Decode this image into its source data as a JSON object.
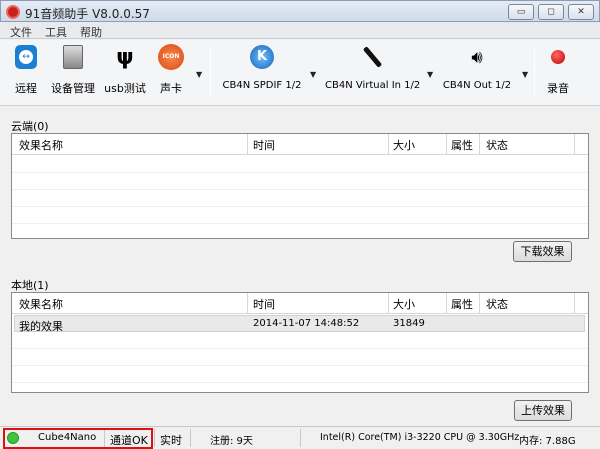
{
  "window": {
    "title": "91音频助手 V8.0.0.57",
    "minimize": "▭",
    "maximize": "◻",
    "close": "✕"
  },
  "menu": [
    "文件",
    "工具",
    "帮助"
  ],
  "toolbar": {
    "items": [
      {
        "label": "远程",
        "icon": "teamviewer-icon"
      },
      {
        "label": "设备管理",
        "icon": "device-manager-icon"
      },
      {
        "label": "usb测试",
        "icon": "usb-icon"
      },
      {
        "label": "声卡",
        "icon": "icon-soundcard-logo",
        "logo_text": "ICON"
      },
      {
        "label": "CB4N SPDIF 1/2",
        "icon": "k-logo-icon",
        "logo_text": "K"
      },
      {
        "label": "CB4N Virtual In 1/2",
        "icon": "microphone-icon"
      },
      {
        "label": "CB4N Out 1/2",
        "icon": "speaker-icon"
      },
      {
        "label": "录音",
        "icon": "record-icon"
      }
    ],
    "dropdown_arrow": "▼"
  },
  "cloud": {
    "label": "云端(0)",
    "columns": [
      "效果名称",
      "时间",
      "大小",
      "属性",
      "状态"
    ],
    "rows": [],
    "button": "下载效果"
  },
  "local": {
    "label": "本地(1)",
    "columns": [
      "效果名称",
      "时间",
      "大小",
      "属性",
      "状态"
    ],
    "rows": [
      {
        "name": "我的效果",
        "time": "2014-11-07 14:48:52",
        "size": "31849",
        "attr": "",
        "status": ""
      }
    ],
    "button": "上传效果"
  },
  "status": {
    "indicator_color": "#3cc43c",
    "device": "Cube4Nano",
    "channel": "通道OK",
    "mode": "实时",
    "registration": "注册: 9天",
    "cpu": "Intel(R) Core(TM) i3-3220 CPU @ 3.30GHz",
    "memory": "内存: 7.88G",
    "highlight_color": "#e01010"
  }
}
